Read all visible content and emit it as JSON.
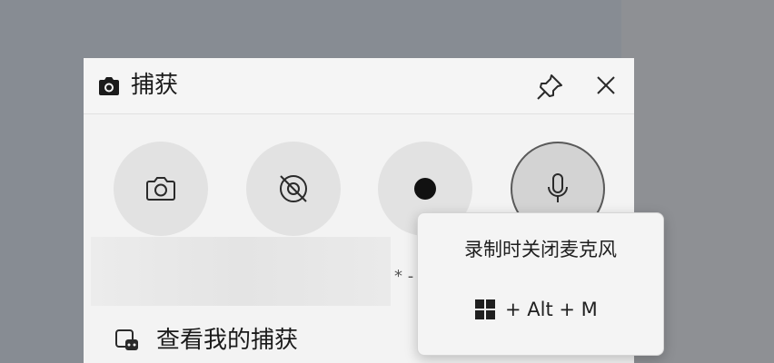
{
  "window": {
    "title": "捕获",
    "icons": {
      "title": "camera-icon",
      "pin": "pin-icon",
      "close": "close-icon"
    }
  },
  "capture_buttons": [
    {
      "name": "screenshot",
      "icon": "camera-icon"
    },
    {
      "name": "screenshot-disabled",
      "icon": "camera-off-icon"
    },
    {
      "name": "start-recording",
      "icon": "record-dot-icon"
    },
    {
      "name": "microphone",
      "icon": "microphone-icon",
      "active": true
    }
  ],
  "hint_text": "* -",
  "view_captures": {
    "label": "查看我的捕获",
    "icon": "gallery-icon"
  },
  "tooltip": {
    "title": "录制时关闭麦克风",
    "shortcut_text": "+ Alt + M",
    "shortcut_icon": "windows-key-icon"
  },
  "colors": {
    "background": "#878c93",
    "card": "#f3f3f3",
    "circle": "#e2e2e2",
    "text": "#1b1b1b"
  }
}
